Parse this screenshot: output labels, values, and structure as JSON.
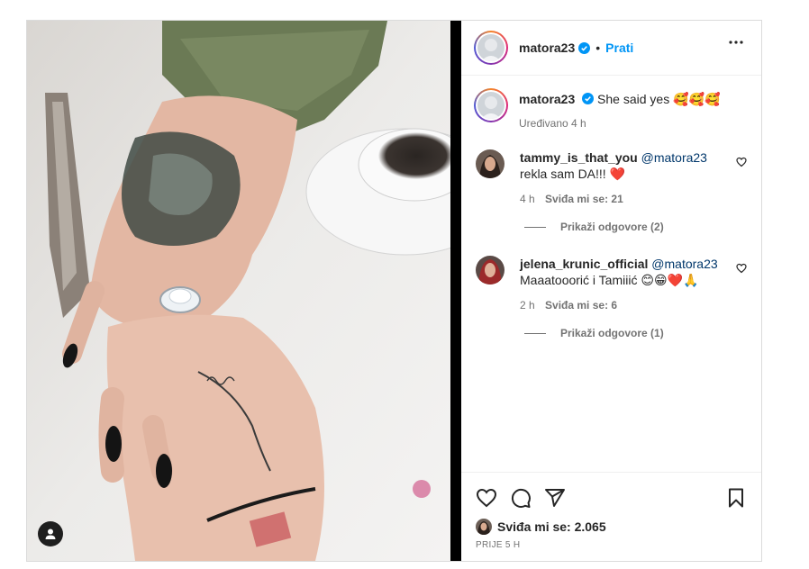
{
  "post": {
    "username": "matora23",
    "follow_label": "Prati",
    "dot": "•"
  },
  "caption": {
    "username": "matora23",
    "text": "She said yes 🥰🥰🥰",
    "edited": "Uređivano",
    "time": "4 h"
  },
  "comments": [
    {
      "username": "tammy_is_that_you",
      "mention": "@matora23",
      "text": "rekla sam DA!!! ❤️",
      "time": "4 h",
      "likes": "Sviđa mi se: 21",
      "replies": "Prikaži odgovore (2)"
    },
    {
      "username": "jelena_krunic_official",
      "mention": "@matora23",
      "text": "Maaatooorić i Tamiiić 😊😁❤️🙏",
      "time": "2 h",
      "likes": "Sviđa mi se: 6",
      "replies": "Prikaži odgovore (1)"
    }
  ],
  "actions": {
    "likes": "Sviđa mi se: 2.065",
    "time_ago": "PRIJE 5 H"
  },
  "icons": {
    "verified": "verified-badge-icon",
    "more": "more-options-icon",
    "like": "heart-icon",
    "comment": "comment-icon",
    "share": "share-icon",
    "save": "bookmark-icon",
    "user_tag": "user-tag-icon"
  },
  "colors": {
    "accent": "#0095f6",
    "verified": "#0095f6",
    "heart": "#ed4956"
  }
}
